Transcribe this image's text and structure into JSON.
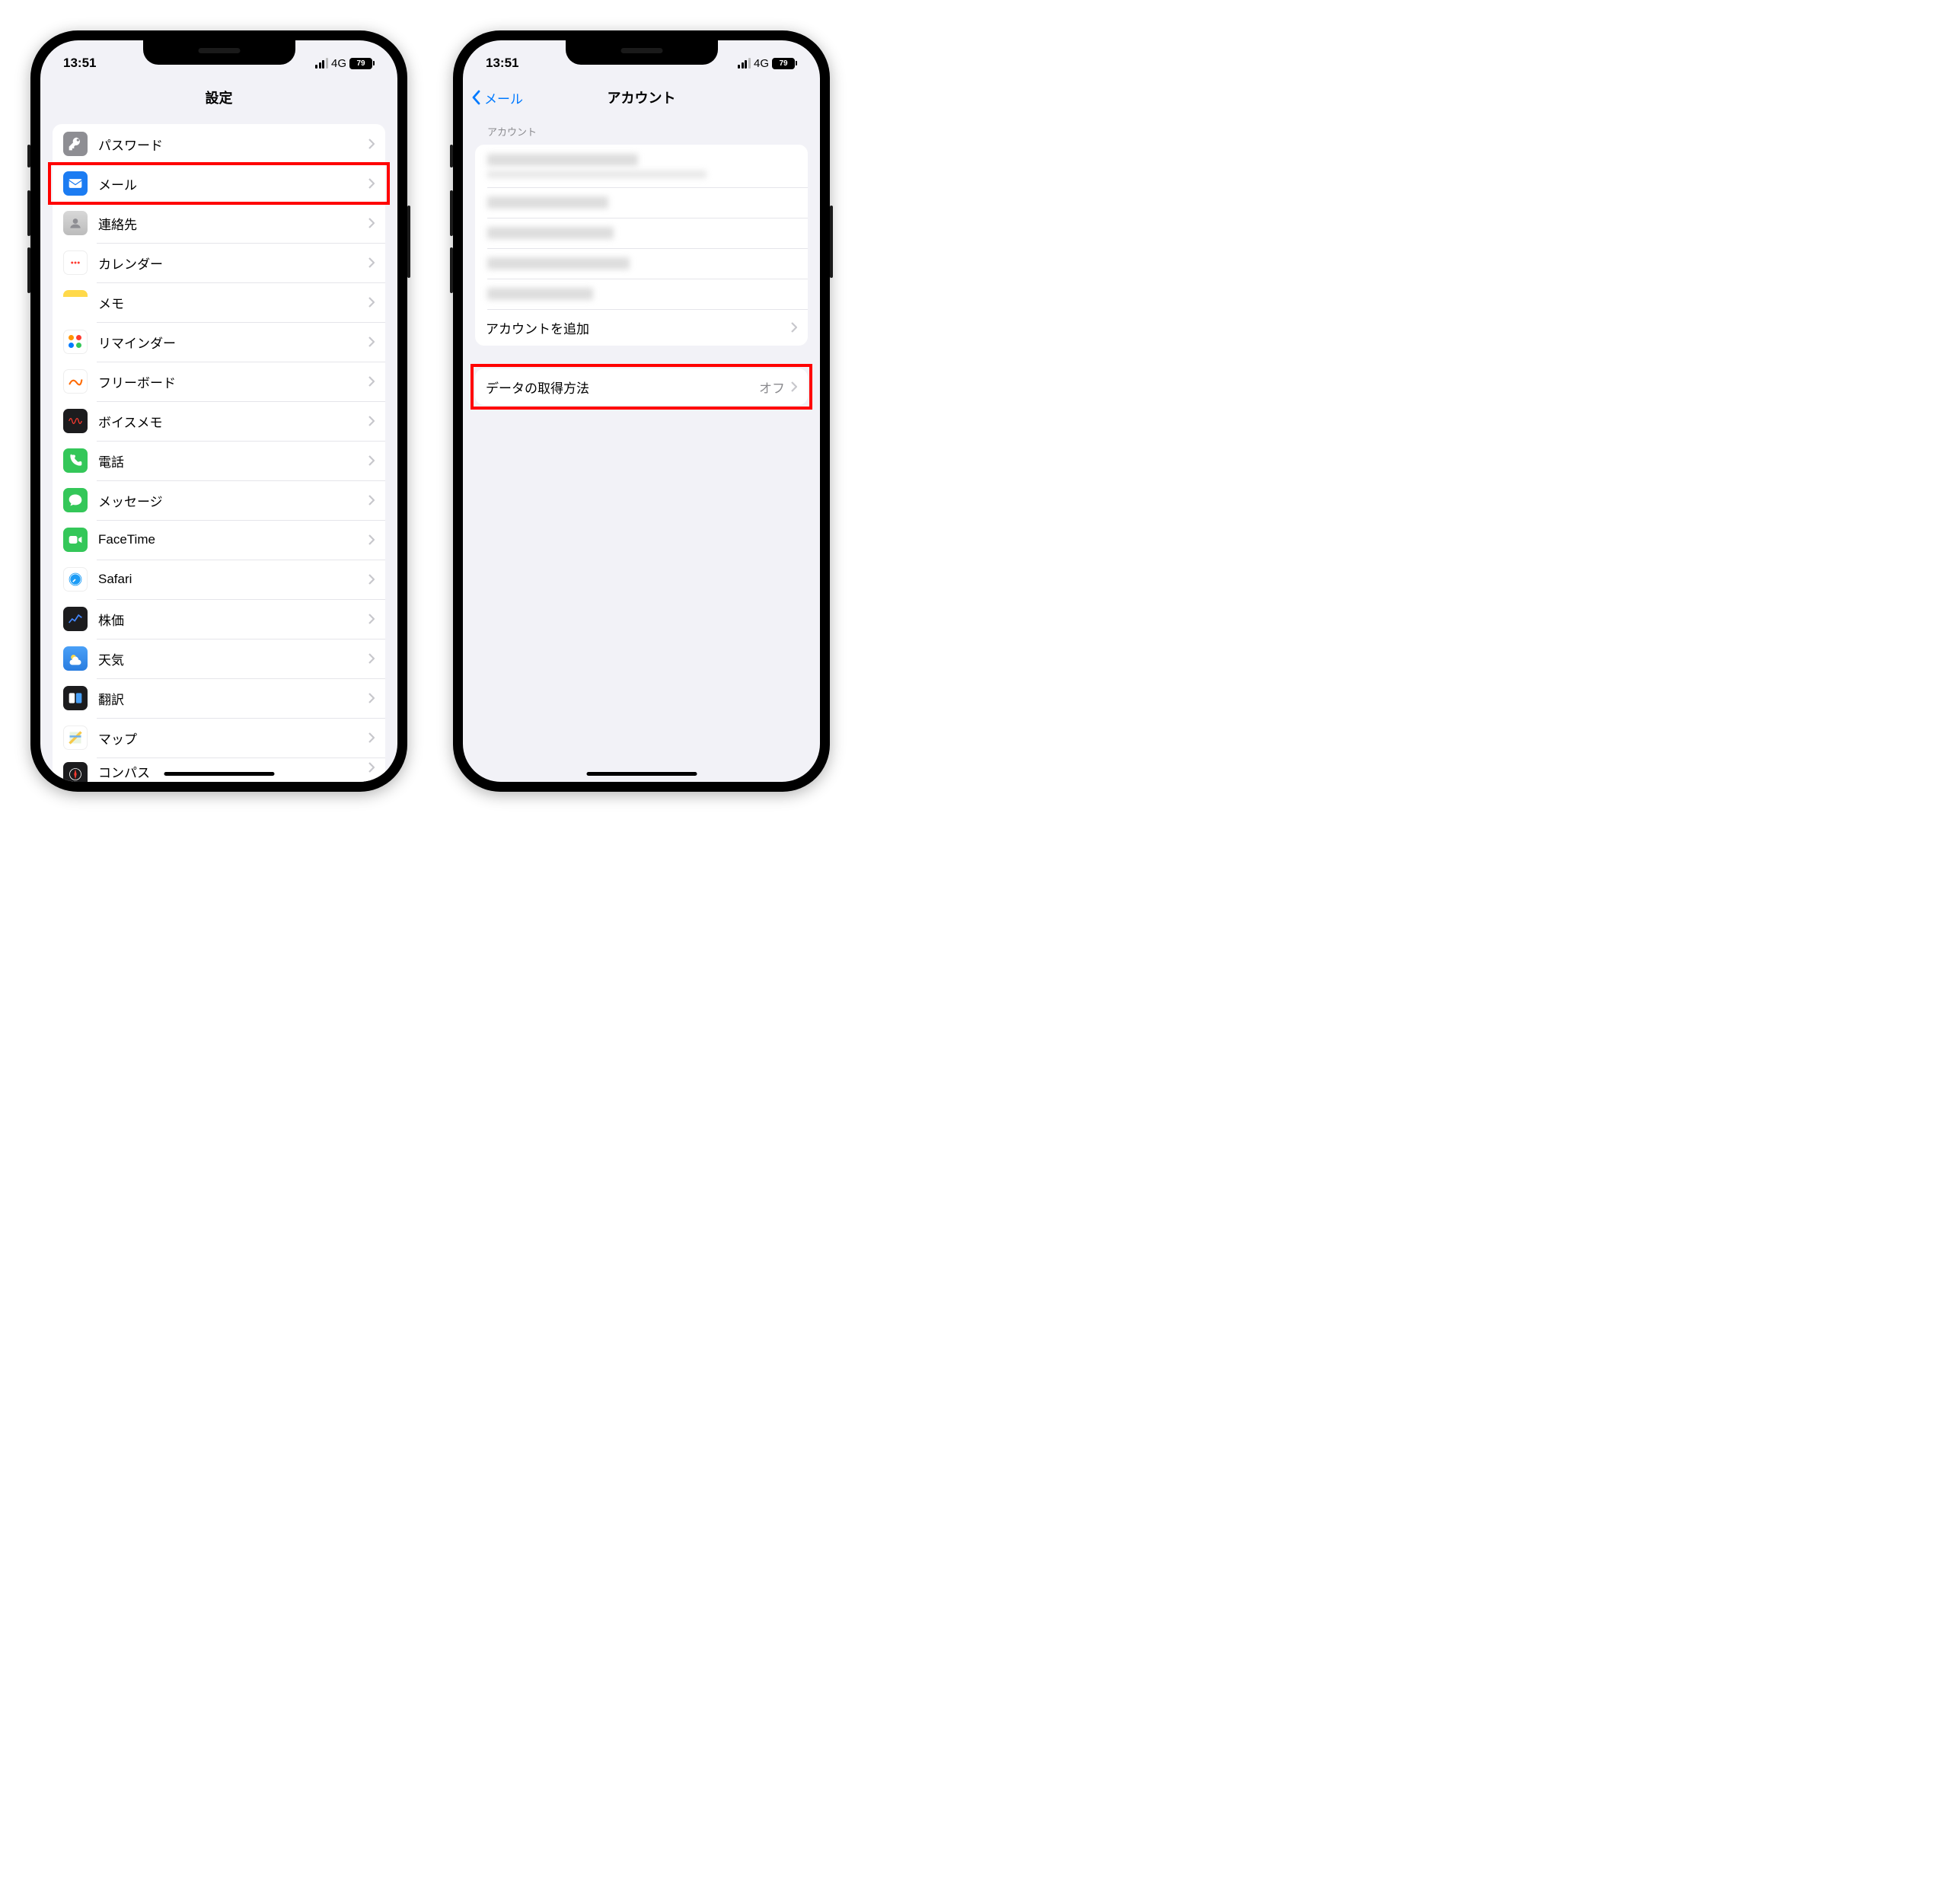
{
  "status": {
    "time": "13:51",
    "network": "4G",
    "battery": "79"
  },
  "left": {
    "title": "設定",
    "items": [
      {
        "id": "passwords",
        "label": "パスワード",
        "icon": "key-icon",
        "iconClass": "ic-passwords"
      },
      {
        "id": "mail",
        "label": "メール",
        "icon": "mail-icon",
        "iconClass": "ic-mail",
        "highlight": true
      },
      {
        "id": "contacts",
        "label": "連絡先",
        "icon": "contacts-icon",
        "iconClass": "ic-contacts"
      },
      {
        "id": "calendar",
        "label": "カレンダー",
        "icon": "calendar-icon",
        "iconClass": "ic-calendar"
      },
      {
        "id": "notes",
        "label": "メモ",
        "icon": "notes-icon",
        "iconClass": "ic-notes"
      },
      {
        "id": "reminders",
        "label": "リマインダー",
        "icon": "reminders-icon",
        "iconClass": "ic-reminders"
      },
      {
        "id": "freeform",
        "label": "フリーボード",
        "icon": "freeform-icon",
        "iconClass": "ic-freeform"
      },
      {
        "id": "voicememo",
        "label": "ボイスメモ",
        "icon": "voicememo-icon",
        "iconClass": "ic-voicememo"
      },
      {
        "id": "phone",
        "label": "電話",
        "icon": "phone-icon",
        "iconClass": "ic-phone"
      },
      {
        "id": "messages",
        "label": "メッセージ",
        "icon": "messages-icon",
        "iconClass": "ic-messages"
      },
      {
        "id": "facetime",
        "label": "FaceTime",
        "icon": "facetime-icon",
        "iconClass": "ic-facetime"
      },
      {
        "id": "safari",
        "label": "Safari",
        "icon": "safari-icon",
        "iconClass": "ic-safari"
      },
      {
        "id": "stocks",
        "label": "株価",
        "icon": "stocks-icon",
        "iconClass": "ic-stocks"
      },
      {
        "id": "weather",
        "label": "天気",
        "icon": "weather-icon",
        "iconClass": "ic-weather"
      },
      {
        "id": "translate",
        "label": "翻訳",
        "icon": "translate-icon",
        "iconClass": "ic-translate"
      },
      {
        "id": "maps",
        "label": "マップ",
        "icon": "maps-icon",
        "iconClass": "ic-maps"
      },
      {
        "id": "compass",
        "label": "コンパス",
        "icon": "compass-icon",
        "iconClass": "ic-compass",
        "partial": true
      }
    ]
  },
  "right": {
    "backLabel": "メール",
    "title": "アカウント",
    "sectionHeader": "アカウント",
    "addAccount": "アカウントを追加",
    "fetchRow": {
      "label": "データの取得方法",
      "value": "オフ",
      "highlight": true
    },
    "blurredAccountCount": 5
  }
}
